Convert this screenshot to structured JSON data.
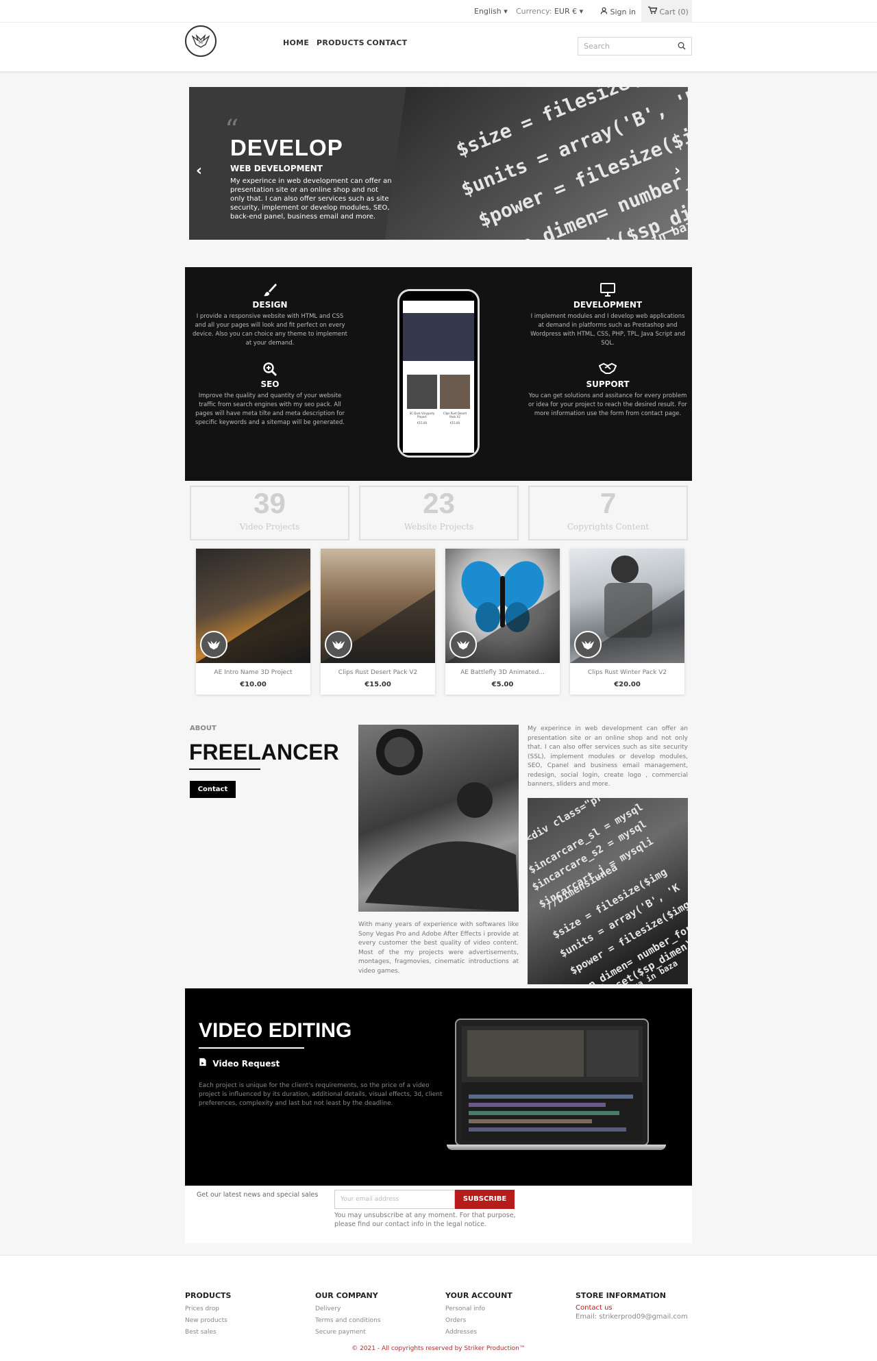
{
  "topnav": {
    "language": "English",
    "currency_label": "Currency:",
    "currency": "EUR €",
    "sign_in": "Sign in",
    "cart": "Cart (0)"
  },
  "header": {
    "menu": [
      "HOME",
      "PRODUCTS",
      "CONTACT"
    ],
    "search_placeholder": "Search"
  },
  "slider": {
    "quote_mark": "“",
    "title": "DEVELOP",
    "subtitle": "WEB DEVELOPMENT",
    "text": "My experince in web development can offer an presentation site or an online shop and not only that. I can also offer services such as site security, implement or develop modules, SEO, back-end panel, business email and more.",
    "prev": "‹",
    "next": "›",
    "code_lines": [
      "$size = filesize($",
      "$units = array('B', 'K",
      "$power = filesize($img",
      "$sp_dimen= number_forma",
      "if(!isset($sp_dimen))",
      "leza in baza"
    ]
  },
  "services": {
    "design": {
      "title": "DESIGN",
      "text": "I provide a responsive website with HTML and CSS and all your pages will look and fit perfect on every device. Also you can choice any theme to implement at your demand."
    },
    "seo": {
      "title": "SEO",
      "text": "Improve the quality and quantity of your website traffic from search engines with my seo pack. All pages will have meta tilte and meta description for specific keywords and a sitemap will be generated."
    },
    "development": {
      "title": "DEVELOPMENT",
      "text": "I implement modules and I develop web applications at demand in platforms such as Prestashop and Wordpress with HTML, CSS, PHP, TPL, Java Script and SQL."
    },
    "support": {
      "title": "SUPPORT",
      "text": "You can get solutions and assitance for every problem or idea for your project to reach the desired result. For more information use the form from contact page."
    },
    "phone_items": [
      {
        "name": "SC Dark Vinyparty Project",
        "price": "€15.00"
      },
      {
        "name": "Clips Rust Desert Pack V2",
        "price": "€15.00"
      }
    ]
  },
  "counters": [
    {
      "value": "39",
      "label": "Video Projects"
    },
    {
      "value": "23",
      "label": "Website Projects"
    },
    {
      "value": "7",
      "label": "Copyrights Content"
    }
  ],
  "products": [
    {
      "name": "AE Intro Name 3D Project",
      "price": "€10.00"
    },
    {
      "name": "Clips Rust Desert Pack V2",
      "price": "€15.00"
    },
    {
      "name": "AE Battlefly 3D Animated...",
      "price": "€5.00"
    },
    {
      "name": "Clips Rust Winter Pack V2",
      "price": "€20.00"
    }
  ],
  "about": {
    "label": "ABOUT",
    "title": "FREELANCER",
    "button": "Contact",
    "text_right": "My experince in web development can offer an presentation site or an online shop and not only that. I can also offer services such as site security (SSL), implement modules or develop modules, SEO, Cpanel and business email management, redesign, social login, create logo , commercial banners, sliders and more.",
    "text_left": "With many years of experience with softwares like Sony Vegas Pro and Adobe After Effects i provide at every customer the best quality of video content. Most of the my projects were advertisements, montages, fragmovies, cinematic introductions at video games.",
    "code_lines": [
      "<div class=\"pr",
      "$incarcare_sl = mysql",
      "$incarcare_s2 = mysql",
      "$incarcart_j = mysqli",
      "//Dimensiunea",
      "$size = filesize($img",
      "$units = array('B', 'K",
      "$power = filesize($img",
      "$sp_dimen= number_format",
      "if(!isset($sp_dimen))",
      "//adauga in baza"
    ]
  },
  "video": {
    "title": "VIDEO EDITING",
    "subtitle": "Video Request",
    "text": "Each project is unique for the client's requirements, so the price of a video project is influenced by its duration, additional details, visual effects, 3d, client preferences, complexity and last but not least by the deadline."
  },
  "newsletter": {
    "text": "Get our latest news and special sales",
    "placeholder": "Your email address",
    "button": "SUBSCRIBE",
    "note": "You may unsubscribe at any moment. For that purpose, please find our contact info in the legal notice."
  },
  "footer": {
    "products": {
      "title": "PRODUCTS",
      "links": [
        "Prices drop",
        "New products",
        "Best sales"
      ]
    },
    "company": {
      "title": "OUR COMPANY",
      "links": [
        "Delivery",
        "Terms and conditions",
        "Secure payment"
      ]
    },
    "account": {
      "title": "YOUR ACCOUNT",
      "links": [
        "Personal info",
        "Orders",
        "Addresses"
      ]
    },
    "store": {
      "title": "STORE INFORMATION",
      "contact": "Contact us",
      "email": "Email: strikerprod09@gmail.com"
    },
    "copyright": "© 2021 - All copyrights reserved by Striker Production™"
  },
  "colors": {
    "accent": "#b71c1c",
    "dark": "#121212",
    "background": "#f6f6f6"
  }
}
